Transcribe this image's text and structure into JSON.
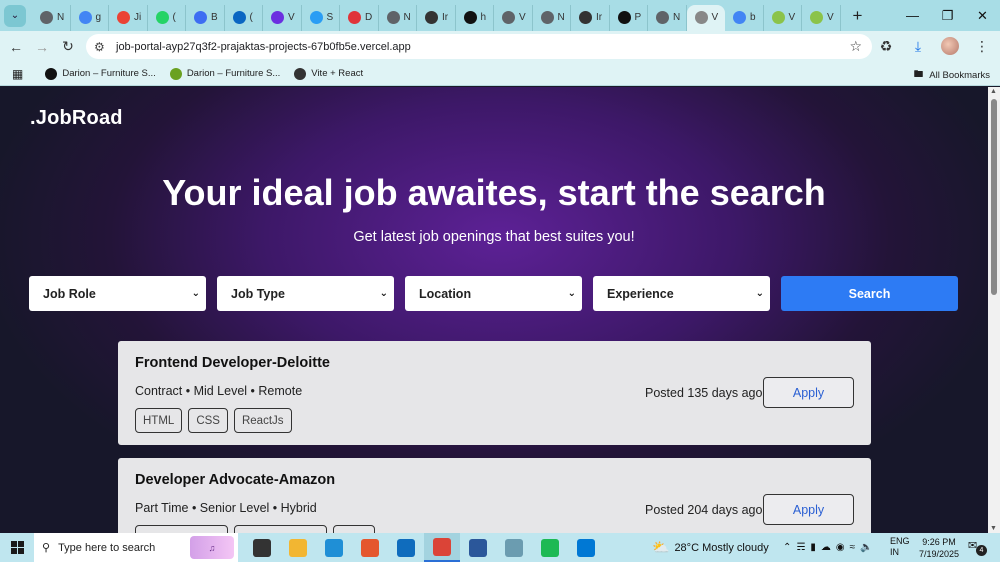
{
  "browser": {
    "tabs": [
      {
        "icon": "chrome-icon",
        "color": "#5f6368",
        "label": "N"
      },
      {
        "icon": "google-icon",
        "color": "#4285f4",
        "label": "g"
      },
      {
        "icon": "gmail-icon",
        "color": "#ea4335",
        "label": "Ji"
      },
      {
        "icon": "whatsapp-icon",
        "color": "#25d366",
        "label": "("
      },
      {
        "icon": "notebook-icon",
        "color": "#3d6df2",
        "label": "B"
      },
      {
        "icon": "linkedin-icon",
        "color": "#0a66c2",
        "label": "("
      },
      {
        "icon": "vite-icon",
        "color": "#6b2fe0",
        "label": "V"
      },
      {
        "icon": "skype-icon",
        "color": "#2a9df4",
        "label": "S"
      },
      {
        "icon": "heart-icon",
        "color": "#e0343a",
        "label": "D"
      },
      {
        "icon": "chrome-icon",
        "color": "#5f6368",
        "label": "N"
      },
      {
        "icon": "openai-icon",
        "color": "#333333",
        "label": "Ir"
      },
      {
        "icon": "github-icon",
        "color": "#111111",
        "label": "h"
      },
      {
        "icon": "chrome-icon",
        "color": "#5f6368",
        "label": "V"
      },
      {
        "icon": "chrome-icon",
        "color": "#5f6368",
        "label": "N"
      },
      {
        "icon": "openai-icon",
        "color": "#333333",
        "label": "Ir"
      },
      {
        "icon": "github-icon",
        "color": "#111111",
        "label": "P"
      },
      {
        "icon": "chrome-icon",
        "color": "#5f6368",
        "label": "N"
      },
      {
        "icon": "vercel-icon",
        "color": "#888888",
        "label": "V",
        "active": true
      },
      {
        "icon": "google-icon",
        "color": "#4285f4",
        "label": "b"
      },
      {
        "icon": "vite-icon",
        "color": "#8bc34a",
        "label": "V"
      },
      {
        "icon": "vite-icon",
        "color": "#8bc34a",
        "label": "V"
      }
    ],
    "url": "job-portal-ayp27q3f2-prajaktas-projects-67b0fb5e.vercel.app",
    "bookmarks": [
      {
        "label": "Darion – Furniture S...",
        "color": "#111111"
      },
      {
        "label": "Darion – Furniture S...",
        "color": "#6aa121"
      },
      {
        "label": "Vite + React",
        "color": "#333333"
      }
    ],
    "all_bookmarks": "All Bookmarks"
  },
  "page": {
    "logo": ".JobRoad",
    "hero_title": "Your ideal job awaites, start the search",
    "hero_subtitle": "Get latest job openings that best suites you!",
    "filters": [
      "Job Role",
      "Job Type",
      "Location",
      "Experience"
    ],
    "search_label": "Search",
    "jobs": [
      {
        "title": "Frontend Developer-Deloitte",
        "meta": "Contract • Mid Level • Remote",
        "tags": [
          "HTML",
          "CSS",
          "ReactJs"
        ],
        "posted": "Posted 135 days ago",
        "apply": "Apply"
      },
      {
        "title": "Developer Advocate-Amazon",
        "meta": "Part Time • Senior Level • Hybrid",
        "tags": [
          "",
          "",
          ""
        ],
        "posted": "Posted 204 days ago",
        "apply": "Apply"
      }
    ]
  },
  "taskbar": {
    "search_placeholder": "Type here to search",
    "apps": [
      {
        "icon": "task-view-icon",
        "color": "#333333"
      },
      {
        "icon": "file-explorer-icon",
        "color": "#f2b632"
      },
      {
        "icon": "edge-icon",
        "color": "#1f8fd6"
      },
      {
        "icon": "office-icon",
        "color": "#e4572e"
      },
      {
        "icon": "outlook-icon",
        "color": "#0f6cbd"
      },
      {
        "icon": "chrome-icon",
        "color": "#db4437",
        "active": true
      },
      {
        "icon": "word-icon",
        "color": "#2b579a"
      },
      {
        "icon": "app-icon",
        "color": "#6b9cb0"
      },
      {
        "icon": "spotify-icon",
        "color": "#1db954"
      },
      {
        "icon": "vscode-icon",
        "color": "#0078d4"
      }
    ],
    "weather": "28°C  Mostly cloudy",
    "lang_line1": "ENG",
    "lang_line2": "IN",
    "time": "9:26 PM",
    "date": "7/19/2025",
    "notifications": "4"
  }
}
